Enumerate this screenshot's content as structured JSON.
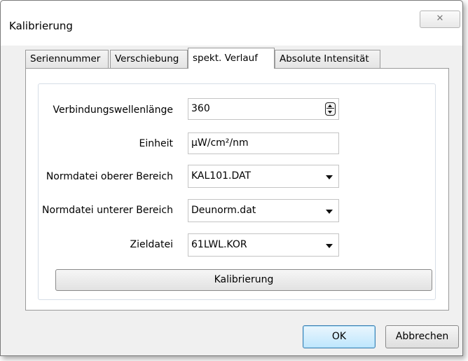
{
  "window": {
    "title": "Kalibrierung",
    "close_glyph": "✕",
    "close_icon": "close-icon"
  },
  "tabs": [
    {
      "label": "Seriennummer",
      "active": false
    },
    {
      "label": "Verschiebung",
      "active": false
    },
    {
      "label": "spekt. Verlauf",
      "active": true
    },
    {
      "label": "Absolute Intensität",
      "active": false
    }
  ],
  "form": {
    "wavelength": {
      "label": "Verbindungswellenlänge",
      "value": "360",
      "icon": "spinner-icon"
    },
    "unit": {
      "label": "Einheit",
      "value": "µW/cm²/nm"
    },
    "upper_file": {
      "label": "Normdatei oberer Bereich",
      "value": "KAL101.DAT",
      "icon": "dropdown-arrow-icon"
    },
    "lower_file": {
      "label": "Normdatei unterer Bereich",
      "value": "Deunorm.dat",
      "icon": "dropdown-arrow-icon"
    },
    "target_file": {
      "label": "Zieldatei",
      "value": "61LWL.KOR",
      "icon": "dropdown-arrow-icon"
    },
    "calibrate_button": "Kalibrierung"
  },
  "footer": {
    "ok_label": "OK",
    "cancel_label": "Abbrechen"
  },
  "colors": {
    "window_bg": "#f0f0f0",
    "panel_bg": "#ffffff",
    "default_button_border": "#3c7fb1"
  }
}
